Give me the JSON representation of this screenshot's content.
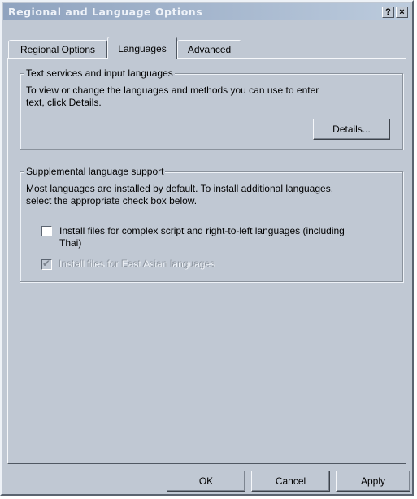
{
  "window": {
    "title": "Regional and Language Options",
    "help_label": "?",
    "close_label": "×"
  },
  "tabs": [
    {
      "label": "Regional Options",
      "active": false
    },
    {
      "label": "Languages",
      "active": true
    },
    {
      "label": "Advanced",
      "active": false
    }
  ],
  "text_services": {
    "legend": "Text services and input languages",
    "description_line1": "To view or change the languages and methods you can use to enter",
    "description_line2": "text, click Details.",
    "details_button": "Details..."
  },
  "supplemental": {
    "legend": "Supplemental language support",
    "description_line1": "Most languages are installed by default. To install additional languages,",
    "description_line2": "select the appropriate check box below.",
    "complex_script": {
      "label_line1": "Install files for complex script and right-to-left languages (including",
      "label_line2": "Thai)",
      "checked": false
    },
    "east_asian": {
      "label": "Install files for East Asian languages",
      "checked": true,
      "disabled": true
    }
  },
  "buttons": {
    "ok": "OK",
    "cancel": "Cancel",
    "apply": "Apply"
  },
  "colors": {
    "dialog_background": "#c0c8d3",
    "titlebar": "#a9bad0"
  }
}
